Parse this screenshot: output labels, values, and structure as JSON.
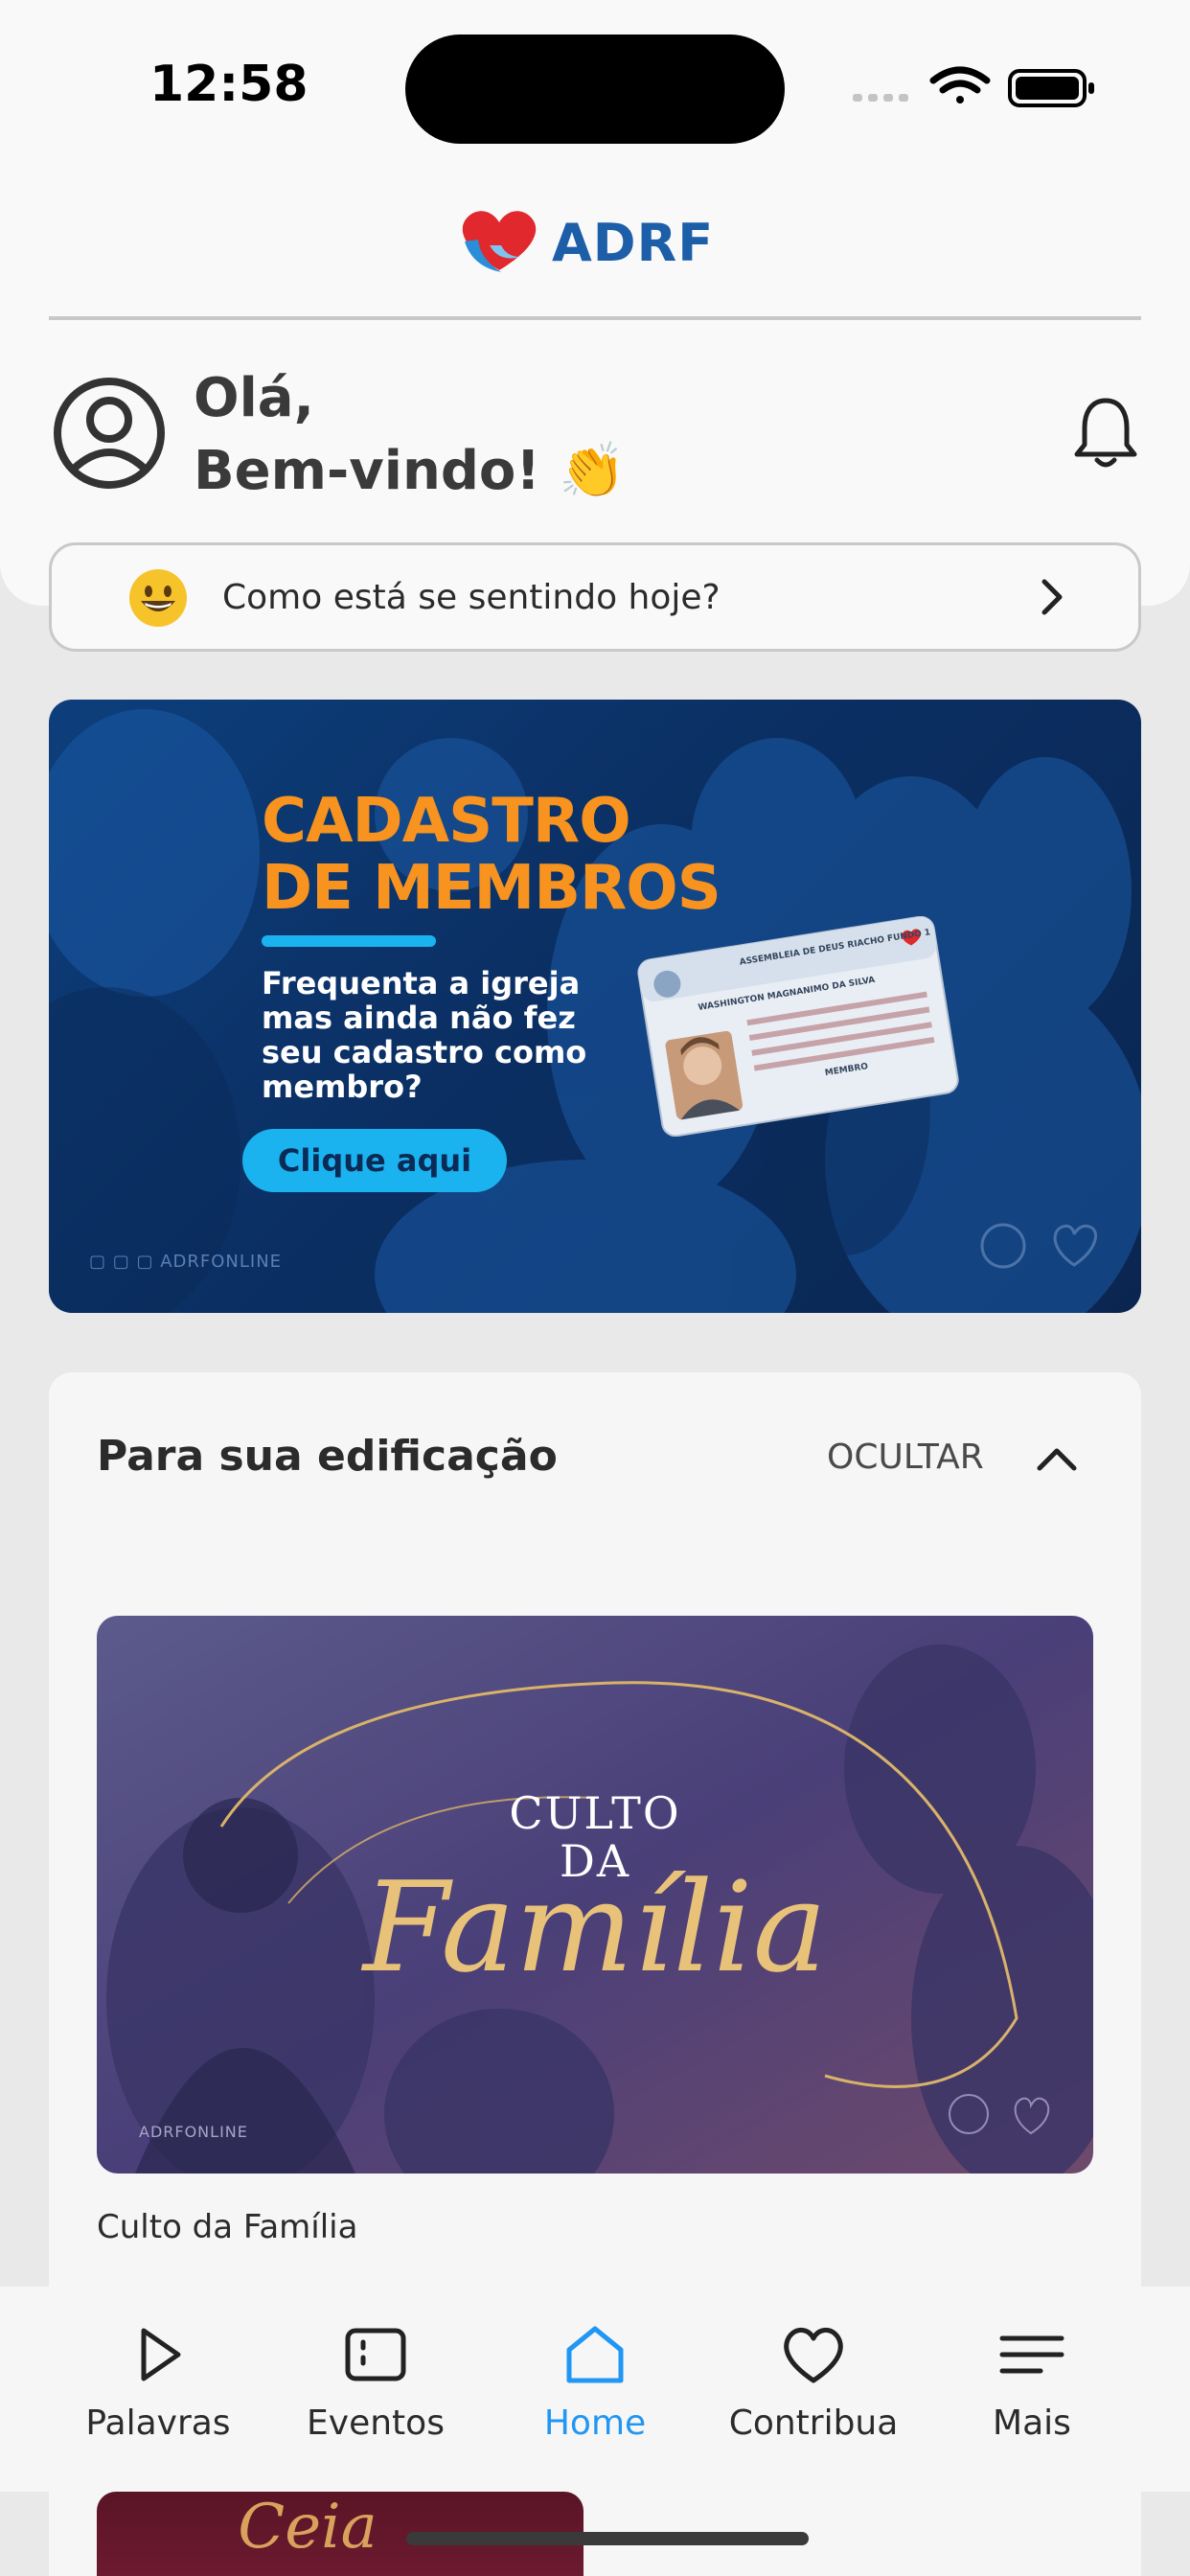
{
  "status_bar": {
    "time": "12:58"
  },
  "header": {
    "logo_text": "ADRF",
    "greeting_line1": "Olá,",
    "greeting_line2": "Bem-vindo! 👏"
  },
  "mood": {
    "emoji": "😀",
    "prompt": "Como está se sentindo hoje?"
  },
  "banner": {
    "title_line1": "CADASTRO",
    "title_line2": "DE MEMBROS",
    "subtitle": "Frequenta a igreja mas ainda não fez seu cadastro como membro?",
    "button_label": "Clique aqui",
    "social_handle": "ADRFONLINE",
    "card_church": "ASSEMBLEIA DE DEUS RIACHO FUNDO 1",
    "card_member_name": "WASHINGTON MAGNANIMO DA SILVA",
    "card_role": "MEMBRO"
  },
  "edification": {
    "title": "Para sua edificação",
    "hide_label": "OCULTAR",
    "video": {
      "thumb_line1": "CULTO",
      "thumb_line2": "DA",
      "thumb_script": "Família",
      "thumb_social": "ADRFONLINE",
      "caption": "Culto da Família"
    },
    "next_thumb_script": "Ceia"
  },
  "tabs": [
    {
      "label": "Palavras",
      "icon": "play-icon",
      "active": false
    },
    {
      "label": "Eventos",
      "icon": "events-icon",
      "active": false
    },
    {
      "label": "Home",
      "icon": "home-icon",
      "active": true
    },
    {
      "label": "Contribua",
      "icon": "heart-icon",
      "active": false
    },
    {
      "label": "Mais",
      "icon": "menu-icon",
      "active": false
    }
  ],
  "colors": {
    "brand_blue": "#1c5ea8",
    "brand_red": "#e0282d",
    "banner_orange": "#f7931e",
    "banner_cyan": "#1ab3ef",
    "active_tab": "#2196f3"
  }
}
